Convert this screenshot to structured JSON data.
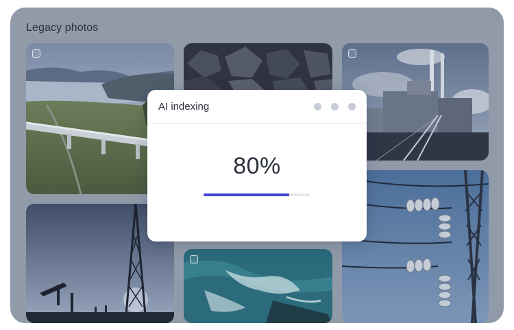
{
  "panel": {
    "title": "Legacy photos"
  },
  "photos": [
    {
      "subject": "pipeline-landscape",
      "checkbox": true
    },
    {
      "subject": "coal-rocks",
      "checkbox": false
    },
    {
      "subject": "power-plant",
      "checkbox": true
    },
    {
      "subject": "oil-derrick",
      "checkbox": false
    },
    {
      "subject": "ocean-waves",
      "checkbox": true
    },
    {
      "subject": "power-line-insulators",
      "checkbox": false
    }
  ],
  "dialog": {
    "title": "AI indexing",
    "progress_text": "80%",
    "progress_value": 0.8,
    "window_dots": 3
  },
  "colors": {
    "panel_bg": "#919aa9",
    "progress_fill": "#4343d6",
    "dot": "#c8ccd9"
  }
}
